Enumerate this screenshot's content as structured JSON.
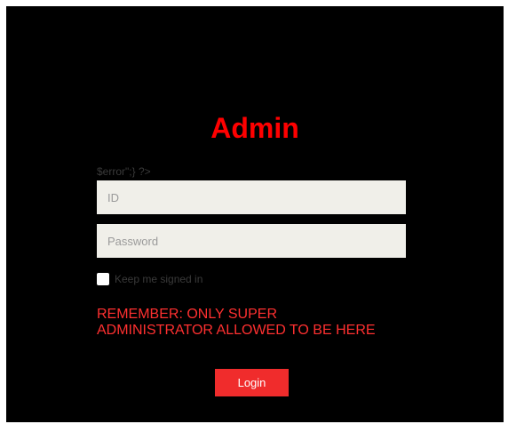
{
  "page": {
    "title": "Admin"
  },
  "form": {
    "error_text": "$error\";} ?>",
    "id_placeholder": "ID",
    "id_value": "",
    "password_placeholder": "Password",
    "password_value": "",
    "keep_signed_in_label": "Keep me signed in",
    "keep_signed_in_checked": false,
    "notice_line1": "REMEMBER: ONLY SUPER",
    "notice_line2": "ADMINISTRATOR ALLOWED TO BE HERE",
    "login_label": "Login"
  },
  "colors": {
    "background": "#000000",
    "accent": "#ff0000",
    "button": "#f02c2c",
    "input_bg": "#f0efe9"
  }
}
